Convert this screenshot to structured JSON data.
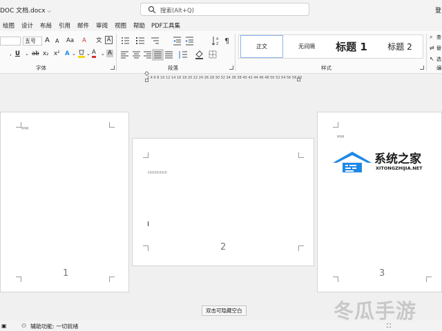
{
  "title_bar": {
    "document_name": "DOC 文档.docx",
    "search_placeholder": "搜索(Alt+Q)",
    "right_cut": "登"
  },
  "menu": {
    "items": [
      "绘图",
      "设计",
      "布局",
      "引用",
      "邮件",
      "审阅",
      "视图",
      "帮助",
      "PDF工具集"
    ]
  },
  "ribbon": {
    "font_size": "五号",
    "bold": "B",
    "italic": "I",
    "grow_font": "A",
    "shrink_font": "A",
    "change_case": "Aa",
    "clear_format": "A",
    "subscript": "x₂",
    "superscript": "x²",
    "text_effects": "A",
    "font_color": "A",
    "char_shading": "A",
    "enclose": "A",
    "wen": "文",
    "font_group_label": "字体",
    "paragraph_group_label": "段落",
    "styles_group_label": "样式",
    "styles": [
      "正文",
      "无间隔",
      "标题 1",
      "标题 2"
    ],
    "editing_partial": [
      "查",
      "替",
      "选"
    ],
    "editing_label_partial": "编"
  },
  "ruler": {
    "ticks": "2 4 6 8 10 12 14 16 18 20 22 24 26 28 30 32 34 36 38 40 42 44 46 48 50 52 54 56 58 60 62 64"
  },
  "pages": [
    {
      "number": "1",
      "text": "哈哈哈"
    },
    {
      "number": "2",
      "text": "幻幻幻幻幻幻幻幻"
    },
    {
      "number": "3",
      "text": "哈哈哈"
    }
  ],
  "watermarks": {
    "brand_cn": "系统之家",
    "brand_en": "XITONGZHIJIA.NET",
    "brand2": "冬瓜手游"
  },
  "tooltip": "双击可隐藏空白",
  "status_bar": {
    "accessibility": "辅助功能: 一切就绪"
  },
  "colors": {
    "accent_blue": "#1e88e5",
    "highlight_yellow": "#f4d400",
    "font_red": "#d32f2f"
  }
}
